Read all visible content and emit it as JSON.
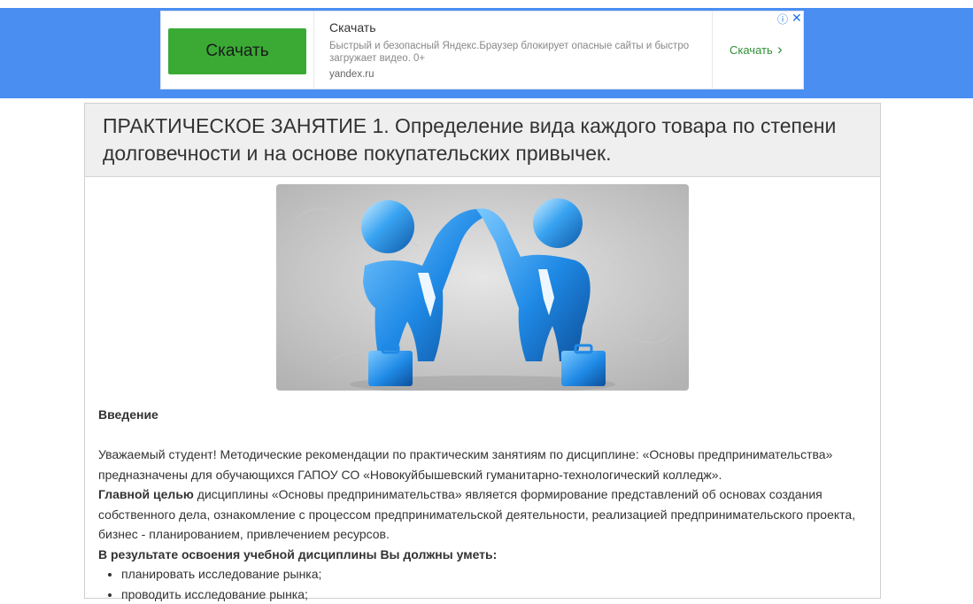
{
  "ad": {
    "button_label": "Скачать",
    "title": "Скачать",
    "description": "Быстрый и безопасный Яндекс.Браузер блокирует опасные сайты и быстро загружает видео. 0+",
    "domain": "yandex.ru",
    "link_label": "Скачать",
    "info_icon": "ⓘ",
    "close_icon": "✕",
    "chevron_icon": "›"
  },
  "article": {
    "title": "ПРАКТИЧЕСКОЕ ЗАНЯТИЕ 1. Определение вида каждого товара по степени долговечности и на основе покупательских привычек.",
    "image_alt": "two-businessmen-high-five-illustration",
    "intro_heading": "Введение",
    "paragraph1": "Уважаемый студент! Методические рекомендации по практическим занятиям по дисциплине: «Основы предпринимательства» предназначены для обучающихся ГАПОУ СО «Новокуйбышевский гуманитарно-технологический колледж».",
    "goal_label": "Главной  целью",
    "goal_text": "   дисциплины  «Основы предпринимательства» является формирование представлений об основах создания собственного дела, ознакомление с процессом предпринимательской деятельности, реализацией предпринимательского проекта, бизнес - планированием, привлечением ресурсов.",
    "skills_heading": "В результате освоения учебной дисциплины Вы должны уметь:",
    "skills": [
      "планировать исследование рынка;",
      "проводить исследование рынка;"
    ]
  },
  "colors": {
    "banner_blue": "#4a8ef2",
    "ad_button_green": "#3aaa35",
    "ad_link_green": "#2f8f35",
    "figure_blue": "#2b8fe0"
  }
}
